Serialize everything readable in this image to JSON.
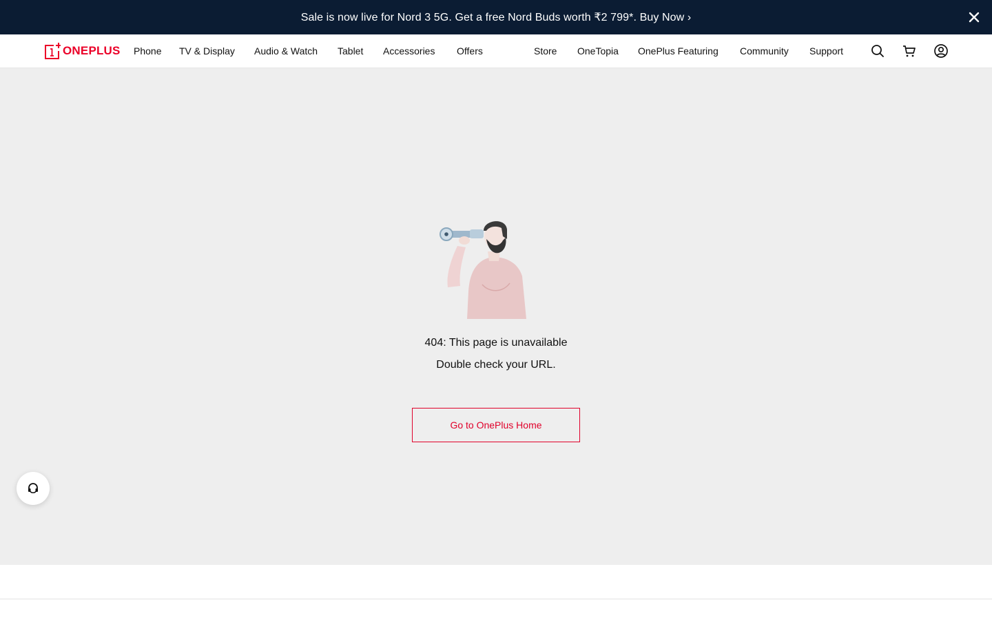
{
  "promo": {
    "text": "Sale is now live for Nord 3 5G. Get a free Nord Buds worth ₹2 799*. Buy Now ›",
    "close_icon": "close-icon"
  },
  "header": {
    "logo_text": "ONEPLUS",
    "nav_left": [
      {
        "label": "Phone"
      },
      {
        "label": "TV & Display"
      },
      {
        "label": "Audio & Watch"
      },
      {
        "label": "Tablet"
      },
      {
        "label": "Accessories"
      },
      {
        "label": "Offers"
      }
    ],
    "nav_right": [
      {
        "label": "Store"
      },
      {
        "label": "OneTopia"
      },
      {
        "label": "OnePlus Featuring"
      },
      {
        "label": "Community"
      },
      {
        "label": "Support"
      }
    ],
    "icons": [
      "search-icon",
      "cart-icon",
      "account-icon"
    ]
  },
  "main": {
    "message_line1": "404: This page is unavailable",
    "message_line2": "Double check your URL.",
    "home_button_label": "Go to OnePlus Home",
    "illustration": "man-with-telescope-illustration"
  },
  "chat": {
    "icon": "headset-support-icon"
  },
  "colors": {
    "promo_bg": "#0b1c33",
    "brand_red": "#eb0028",
    "page_bg": "#eeeeee"
  }
}
